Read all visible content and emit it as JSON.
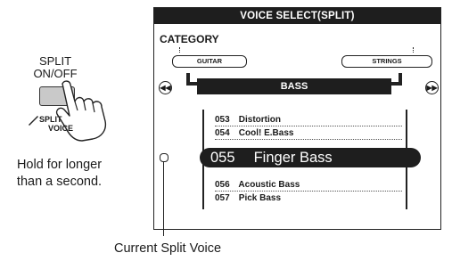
{
  "button": {
    "label_line1": "SPLIT",
    "label_line2": "ON/OFF",
    "tag_line1": "SPLIT",
    "tag_line2": "VOICE"
  },
  "instruction": {
    "line1": "Hold for longer",
    "line2": "than a second."
  },
  "lcd": {
    "title": "VOICE SELECT(SPLIT)",
    "category_label": "CATEGORY",
    "category_prev": "GUITAR",
    "category_next": "STRINGS",
    "current_category": "BASS",
    "nav_prev_icon": "rewind-icon",
    "nav_next_icon": "fast-forward-icon",
    "voices": [
      {
        "num": "053",
        "name": "Distortion"
      },
      {
        "num": "054",
        "name": "Cool! E.Bass"
      },
      {
        "num": "055",
        "name": "Finger Bass"
      },
      {
        "num": "056",
        "name": "Acoustic Bass"
      },
      {
        "num": "057",
        "name": "Pick Bass"
      }
    ]
  },
  "caption": "Current Split Voice"
}
